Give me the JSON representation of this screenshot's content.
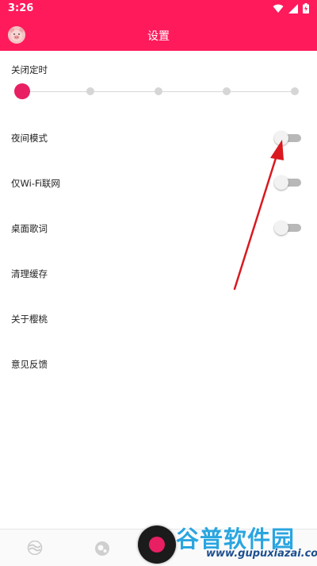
{
  "status": {
    "time": "3:26"
  },
  "header": {
    "title": "设置"
  },
  "timer": {
    "label": "关闭定时",
    "selected_index": 0,
    "stops": 5
  },
  "settings": {
    "night_mode": {
      "label": "夜间模式",
      "on": false
    },
    "wifi_only": {
      "label": "仅Wi-Fi联网",
      "on": false
    },
    "desktop_lyrics": {
      "label": "桌面歌词",
      "on": false
    },
    "clear_cache": {
      "label": "清理缓存"
    },
    "about": {
      "label": "关于樱桃"
    },
    "feedback": {
      "label": "意见反馈"
    }
  },
  "watermark": {
    "brand": "谷普软件园",
    "url": "www.gupuxiazai.com"
  },
  "colors": {
    "accent": "#ff1a5c",
    "thumb": "#e81f63",
    "annotation_arrow": "#d9191f"
  }
}
